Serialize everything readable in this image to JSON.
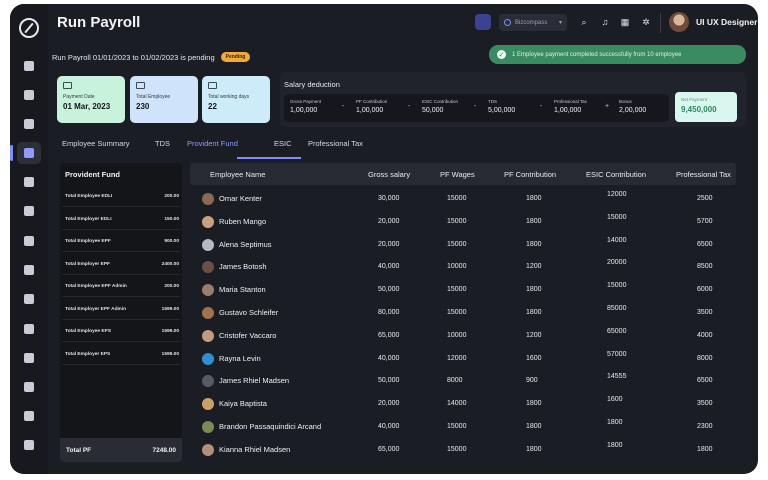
{
  "page": {
    "title": "Run Payroll"
  },
  "header": {
    "company": "Bizcompass",
    "user_name": "UI UX Designer",
    "icons": [
      "search-icon",
      "bell-icon",
      "grid-icon",
      "gear-icon"
    ]
  },
  "sidebar": {
    "icons": [
      "home-icon",
      "user-icon",
      "briefcase-icon",
      "payroll-icon",
      "add-user-icon",
      "user-settings-icon",
      "table-icon",
      "gear-icon",
      "chart-icon",
      "id-card-icon",
      "code-icon",
      "trophy-icon",
      "activity-icon",
      "logout-icon"
    ],
    "active_index": 3
  },
  "status": {
    "pending_text": "Run Payroll 01/01/2023 to 01/02/2023 is pending",
    "pending_badge": "Pending",
    "toast": "1 Employee payment completed successfully from 10 employee"
  },
  "stats": [
    {
      "label": "Payment Date",
      "value": "01 Mar, 2023",
      "color": "#c8f2dc"
    },
    {
      "label": "Total Employee",
      "value": "230",
      "color": "#cfe3fb"
    },
    {
      "label": "Total working days",
      "value": "22",
      "color": "#cdebf8"
    }
  ],
  "deduction": {
    "title": "Salary deduction",
    "items": [
      {
        "label": "Gross Payment",
        "value": "1,00,000"
      },
      {
        "label": "PF Contribution",
        "value": "1,00,000"
      },
      {
        "label": "ESIC Contribution",
        "value": "50,000"
      },
      {
        "label": "TDS",
        "value": "5,00,000"
      },
      {
        "label": "Professional Tax",
        "value": "1,00,000"
      },
      {
        "label": "Bonus",
        "value": "2,00,000"
      }
    ],
    "operators": [
      "-",
      "-",
      "-",
      "-",
      "+"
    ],
    "net": {
      "label": "Net Payment",
      "value": "9,450,000"
    }
  },
  "tabs": [
    "Employee Summary",
    "TDS",
    "Provident Fund",
    "ESIC",
    "Professional Tax"
  ],
  "active_tab": "Provident Fund",
  "provident_fund": {
    "title": "Provident Fund",
    "rows": [
      {
        "label": "Total Employee EDLI",
        "value": "200.00"
      },
      {
        "label": "Total Employer EDLI",
        "value": "150.00"
      },
      {
        "label": "Total Employee EPF",
        "value": "900.00"
      },
      {
        "label": "Total Employer EPF",
        "value": "2400.00"
      },
      {
        "label": "Total Employee EPF Admin",
        "value": "200.00"
      },
      {
        "label": "Total Employer EPF Admin",
        "value": "1599.00"
      },
      {
        "label": "Total Employee EPS",
        "value": "1599.00"
      },
      {
        "label": "Total Employer EPS",
        "value": "1599.00"
      }
    ],
    "total_label": "Total  PF",
    "total_value": "7248.00"
  },
  "table": {
    "columns": [
      "Employee Name",
      "Gross salary",
      "PF Wages",
      "PF Contribution",
      "ESIC Contribution",
      "Professional Tax"
    ],
    "rows": [
      {
        "name": "Omar Kenter",
        "gross": "30,000",
        "pf_wages": "15000",
        "pf": "1800",
        "esic": "12000",
        "ptax": "2500"
      },
      {
        "name": "Ruben Mango",
        "gross": "20,000",
        "pf_wages": "15000",
        "pf": "1800",
        "esic": "15000",
        "ptax": "5700"
      },
      {
        "name": "Alena Septimus",
        "gross": "20,000",
        "pf_wages": "15000",
        "pf": "1800",
        "esic": "14000",
        "ptax": "6500"
      },
      {
        "name": "James Botosh",
        "gross": "40,000",
        "pf_wages": "10000",
        "pf": "1200",
        "esic": "20000",
        "ptax": "8500"
      },
      {
        "name": "Maria Stanton",
        "gross": "50,000",
        "pf_wages": "15000",
        "pf": "1800",
        "esic": "15000",
        "ptax": "6000"
      },
      {
        "name": "Gustavo Schleifer",
        "gross": "80,000",
        "pf_wages": "15000",
        "pf": "1800",
        "esic": "85000",
        "ptax": "3500"
      },
      {
        "name": "Cristofer Vaccaro",
        "gross": "65,000",
        "pf_wages": "10000",
        "pf": "1200",
        "esic": "65000",
        "ptax": "4000"
      },
      {
        "name": "Rayna Levin",
        "gross": "40,000",
        "pf_wages": "12000",
        "pf": "1600",
        "esic": "57000",
        "ptax": "8000"
      },
      {
        "name": "James Rhiel Madsen",
        "gross": "50,000",
        "pf_wages": "8000",
        "pf": "900",
        "esic": "14555",
        "ptax": "6500"
      },
      {
        "name": "Kaiya Baptista",
        "gross": "20,000",
        "pf_wages": "14000",
        "pf": "1800",
        "esic": "1600",
        "ptax": "3500"
      },
      {
        "name": "Brandon Passaquindici Arcand",
        "gross": "40,000",
        "pf_wages": "15000",
        "pf": "1800",
        "esic": "1800",
        "ptax": "2300"
      },
      {
        "name": "Kianna Rhiel Madsen",
        "gross": "65,000",
        "pf_wages": "15000",
        "pf": "1800",
        "esic": "1800",
        "ptax": "1800"
      }
    ]
  }
}
